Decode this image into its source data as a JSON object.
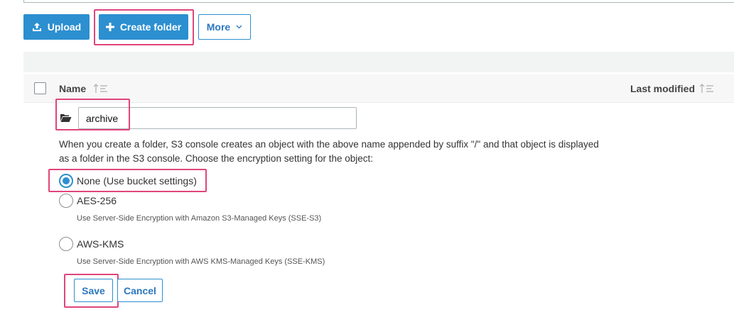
{
  "toolbar": {
    "upload_label": "Upload",
    "create_folder_label": "Create folder",
    "more_label": "More"
  },
  "table": {
    "name_header": "Name",
    "last_modified_header": "Last modified"
  },
  "new_folder": {
    "name_value": "archive",
    "info_text": "When you create a folder, S3 console creates an object with the above name appended by suffix \"/\" and that object is displayed as a folder in the S3 console. Choose the encryption setting for the object:",
    "options": [
      {
        "label": "None (Use bucket settings)",
        "description": "",
        "selected": true
      },
      {
        "label": "AES-256",
        "description": "Use Server-Side Encryption with Amazon S3-Managed Keys (SSE-S3)",
        "selected": false
      },
      {
        "label": "AWS-KMS",
        "description": "Use Server-Side Encryption with AWS KMS-Managed Keys (SSE-KMS)",
        "selected": false
      }
    ],
    "save_label": "Save",
    "cancel_label": "Cancel"
  },
  "colors": {
    "primary": "#2c8fd0",
    "highlight": "#e0457b",
    "header_bg": "#f7f7f7"
  },
  "icons": [
    "upload-icon",
    "plus-icon",
    "chevron-down-icon",
    "sort-icon",
    "folder-open-icon"
  ]
}
